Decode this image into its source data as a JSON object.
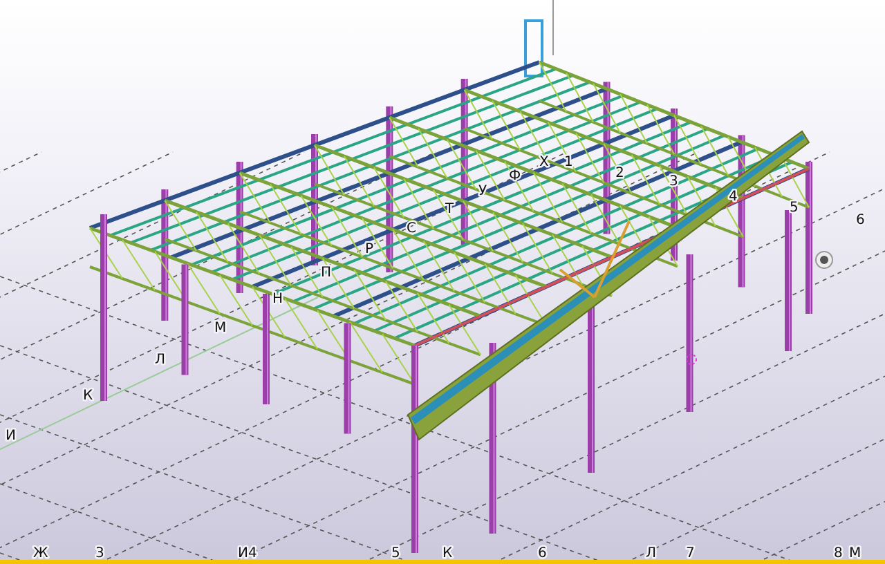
{
  "model_view": {
    "grid_labels": [
      "И",
      "К",
      "Л",
      "М",
      "Н",
      "П",
      "Р",
      "С",
      "Т",
      "У",
      "Ф",
      "Х",
      "1",
      "2",
      "3",
      "4",
      "5",
      "6"
    ],
    "edge_labels": [
      "Ж",
      "3",
      "И4",
      "5",
      "К",
      "6",
      "Л",
      "7",
      "8",
      "М"
    ]
  }
}
